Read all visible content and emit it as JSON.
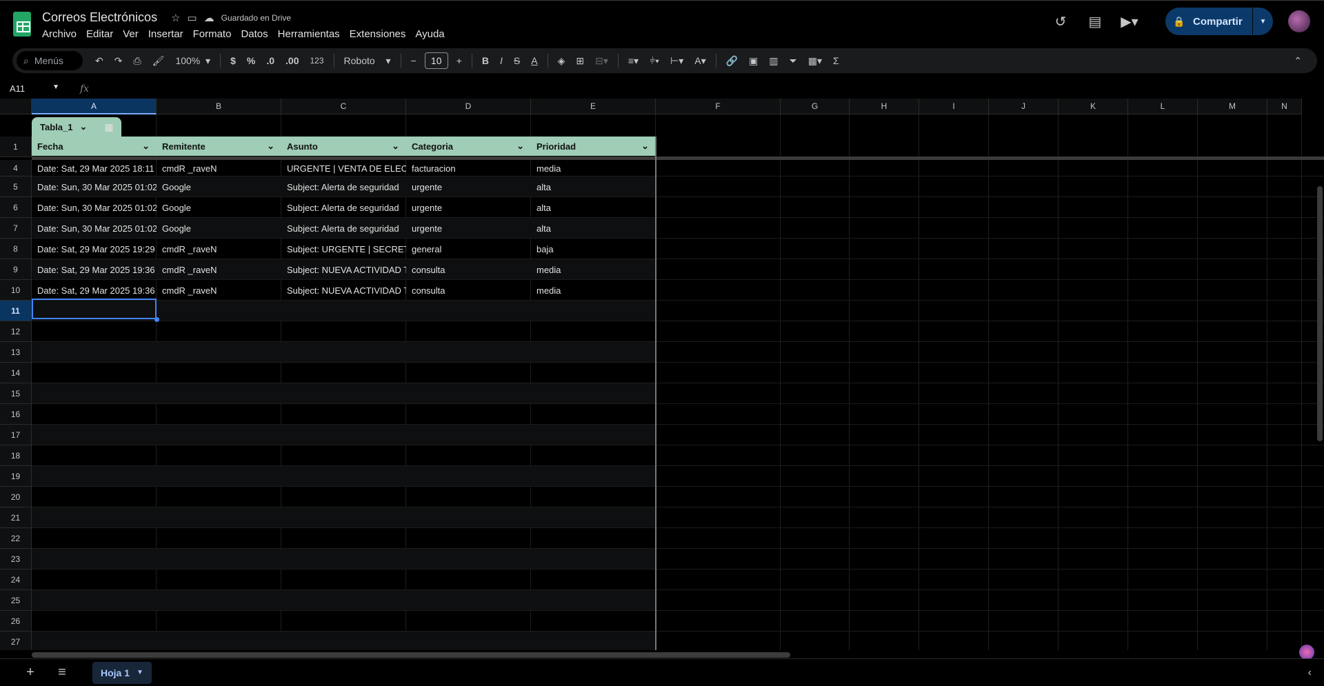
{
  "app": {
    "title": "Correos Electrónicos",
    "saved_status": "Guardado en Drive",
    "share_label": "Compartir"
  },
  "menu": [
    "Archivo",
    "Editar",
    "Ver",
    "Insertar",
    "Formato",
    "Datos",
    "Herramientas",
    "Extensiones",
    "Ayuda"
  ],
  "toolbar": {
    "search_placeholder": "Menús",
    "zoom": "100%",
    "currency": "$",
    "percent": "%",
    "dec_decrease": ".0",
    "dec_increase": ".00",
    "number_format": "123",
    "font_name": "Roboto",
    "font_size": "10",
    "bold": "B",
    "italic": "I",
    "strike": "S",
    "text_color": "A",
    "sum": "Σ"
  },
  "formula_bar": {
    "name_box": "A11",
    "fx": "fx",
    "value": ""
  },
  "columns": [
    "A",
    "B",
    "C",
    "D",
    "E",
    "F",
    "G",
    "H",
    "I",
    "J",
    "K",
    "L",
    "M",
    "N"
  ],
  "table": {
    "name": "Tabla_1",
    "headers": [
      "Fecha",
      "Remitente",
      "Asunto",
      "Categoria",
      "Prioridad"
    ],
    "rows": [
      {
        "row": "4",
        "cells": [
          "Date: Sat, 29 Mar 2025 18:11",
          "cmdR _raveN",
          "URGENTE | VENTA DE ELECT",
          "facturacion",
          "media"
        ]
      },
      {
        "row": "5",
        "cells": [
          "Date: Sun, 30 Mar 2025 01:02",
          "Google",
          "Subject: Alerta de seguridad",
          "urgente",
          "alta"
        ]
      },
      {
        "row": "6",
        "cells": [
          "Date: Sun, 30 Mar 2025 01:02",
          "Google",
          "Subject: Alerta de seguridad",
          "urgente",
          "alta"
        ]
      },
      {
        "row": "7",
        "cells": [
          "Date: Sun, 30 Mar 2025 01:02",
          "Google",
          "Subject: Alerta de seguridad",
          "urgente",
          "alta"
        ]
      },
      {
        "row": "8",
        "cells": [
          "Date: Sat, 29 Mar 2025 19:29",
          "cmdR _raveN",
          "Subject: URGENTE | SECRETA",
          "general",
          "baja"
        ]
      },
      {
        "row": "9",
        "cells": [
          "Date: Sat, 29 Mar 2025 19:36",
          "cmdR _raveN",
          "Subject: NUEVA ACTIVIDAD T",
          "consulta",
          "media"
        ]
      },
      {
        "row": "10",
        "cells": [
          "Date: Sat, 29 Mar 2025 19:36",
          "cmdR _raveN",
          "Subject: NUEVA ACTIVIDAD T",
          "consulta",
          "media"
        ]
      }
    ]
  },
  "header_row": "1",
  "empty_rows": [
    "11",
    "12",
    "13",
    "14",
    "15",
    "16",
    "17",
    "18",
    "19",
    "20",
    "21",
    "22",
    "23",
    "24",
    "25",
    "26",
    "27"
  ],
  "sheet_tab": "Hoja 1",
  "colors": {
    "table_header": "#9fcdb5",
    "selection": "#4285f4",
    "share_bg": "#0b3a6a"
  }
}
